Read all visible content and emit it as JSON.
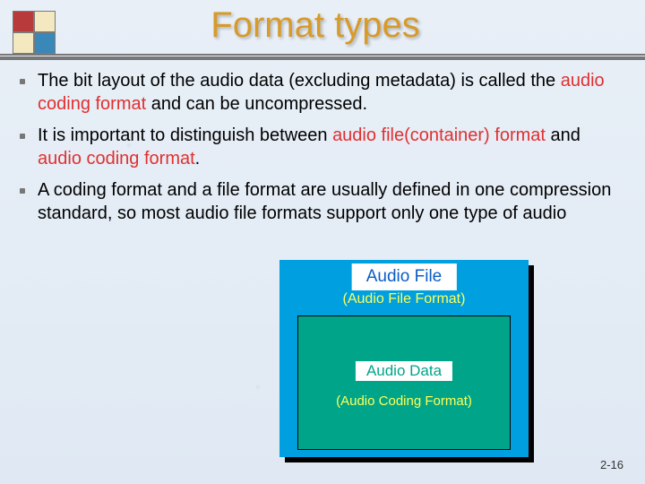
{
  "title": "Format types",
  "bullets": [
    {
      "pre": "The bit layout of the audio data (excluding metadata) is called the ",
      "r1": "audio coding format",
      "post": " and can be uncompressed."
    },
    {
      "pre": "It is important to distinguish between ",
      "r1": "audio file(container) format",
      "mid": " and ",
      "r2": "audio coding format",
      "post": "."
    },
    {
      "pre": "A coding format and a file format are usually defined in one compression standard, so most audio file formats support only one type of audio"
    }
  ],
  "diagram": {
    "outer_label": "Audio File",
    "outer_sub": "(Audio File Format)",
    "inner_label": "Audio Data",
    "inner_sub": "(Audio Coding Format)"
  },
  "page": "2-16"
}
